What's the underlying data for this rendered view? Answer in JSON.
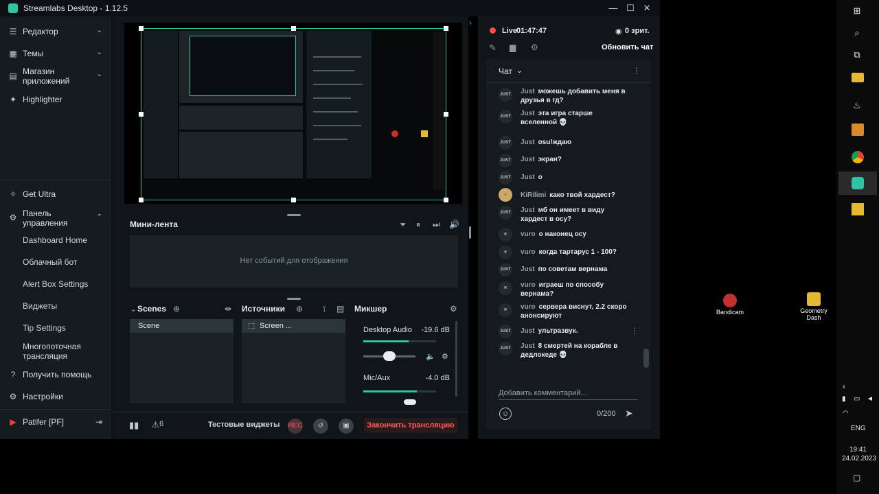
{
  "app": {
    "title": "Streamlabs Desktop - 1.12.5"
  },
  "window_controls": {
    "minimize": "—",
    "maximize": "☐",
    "close": "✕"
  },
  "sidebar": {
    "top_items": [
      {
        "label": "Редактор",
        "icon": "editor-icon",
        "chevron": "⌄"
      },
      {
        "label": "Темы",
        "icon": "themes-icon",
        "chevron": "⌄"
      },
      {
        "label": "Магазин приложений",
        "icon": "store-icon",
        "chevron": "⌄"
      },
      {
        "label": "Highlighter",
        "icon": "highlighter-icon"
      }
    ],
    "get_ultra": "Get Ultra",
    "dashboard": {
      "label": "Панель управления",
      "chevron": "⌃"
    },
    "sub_items": [
      "Dashboard Home",
      "Облачный бот",
      "Alert Box Settings",
      "Виджеты",
      "Tip Settings",
      "Многопоточная трансляция"
    ],
    "help": "Получить помощь",
    "settings": "Настройки",
    "profile": "Patifer [PF]"
  },
  "minifeed": {
    "title": "Мини-лента",
    "empty": "Нет событий для отображения"
  },
  "scenes": {
    "title": "Scenes",
    "items": [
      "Scene"
    ]
  },
  "sources": {
    "title": "Источники",
    "items": [
      "Screen ..."
    ]
  },
  "mixer": {
    "title": "Микшер",
    "channels": [
      {
        "name": "Desktop Audio",
        "db": "-19.6 dB",
        "level": 0.62
      },
      {
        "name": "Mic/Aux",
        "db": "-4.0 dB",
        "level": 0.74
      }
    ]
  },
  "footer": {
    "alerts_count": "6",
    "test_widgets": "Тестовые виджеты",
    "rec": "REC",
    "end_stream": "Закончить трансляцию"
  },
  "stream": {
    "status": "Live",
    "time": "01:47:47",
    "viewers": "0 зрит.",
    "refresh_chat": "Обновить чат"
  },
  "chat": {
    "title": "Чат",
    "messages": [
      {
        "user": "Just",
        "text": "можешь добавить меня в друзья в гд?"
      },
      {
        "user": "Just",
        "text": "эта игра старше вселенной 💀"
      },
      {
        "user": "Just",
        "text": "osu!ждаю"
      },
      {
        "user": "Just",
        "text": "экран?"
      },
      {
        "user": "Just",
        "text": "о"
      },
      {
        "user": "KiRilimi",
        "text": "како твой хардест?"
      },
      {
        "user": "Just",
        "text": "мб он имеет в виду хардест в осу?"
      },
      {
        "user": "vuro",
        "text": "о наконец осу"
      },
      {
        "user": "vuro",
        "text": "когда тартарус 1 - 100?"
      },
      {
        "user": "Just",
        "text": "по советам вернама"
      },
      {
        "user": "vuro",
        "text": "играеш по способу вернама?"
      },
      {
        "user": "vuro",
        "text": "сервера виснут, 2.2 скоро анонсируют"
      },
      {
        "user": "Just",
        "text": "ультразвук."
      },
      {
        "user": "Just",
        "text": "8 смертей на корабле в дедлокеде 💀"
      }
    ],
    "input_placeholder": "Добавить комментарий...",
    "counter": "0/200"
  },
  "desktop_icons": [
    {
      "label": "Bandicam",
      "color": "#c4302b"
    },
    {
      "label": "Geometry Dash",
      "color": "#e5b92f"
    }
  ],
  "taskbar": {
    "lang": "ENG",
    "time": "19:41",
    "date": "24.02.2023"
  }
}
